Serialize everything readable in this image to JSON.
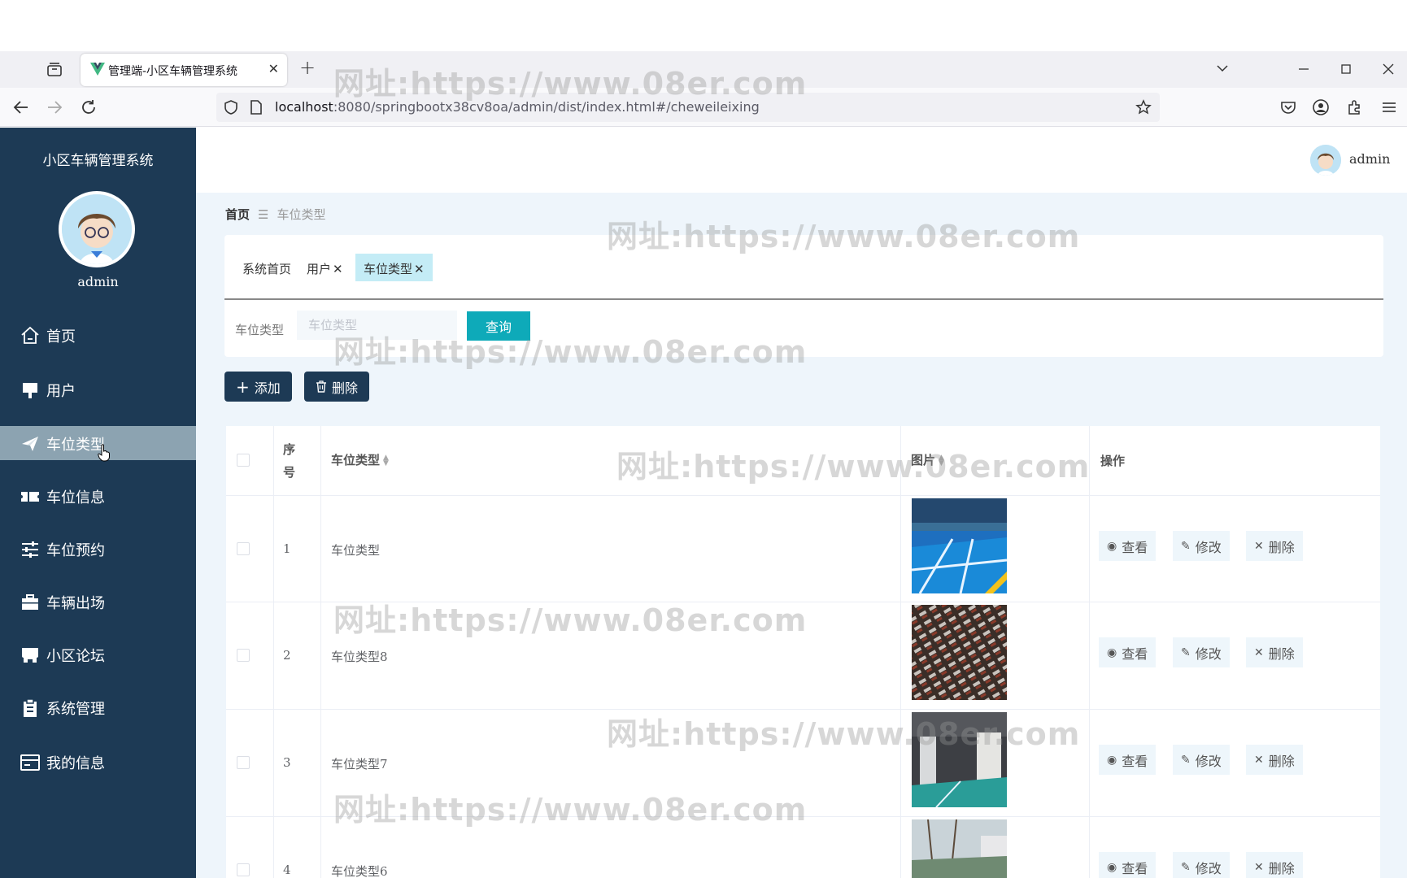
{
  "browser": {
    "tab_title": "管理端-小区车辆管理系统",
    "tab_close": "✕",
    "new_tab": "+",
    "url_host": "localhost",
    "url_rest": ":8080/springbootx38cv8oa/admin/dist/index.html#/cheweileixing"
  },
  "sidebar": {
    "title": "小区车辆管理系统",
    "username": "admin",
    "items": [
      {
        "label": "首页",
        "icon": "home-icon"
      },
      {
        "label": "用户",
        "icon": "user-icon"
      },
      {
        "label": "车位类型",
        "icon": "send-icon"
      },
      {
        "label": "车位信息",
        "icon": "ticket-icon"
      },
      {
        "label": "车位预约",
        "icon": "sliders-icon"
      },
      {
        "label": "车辆出场",
        "icon": "briefcase-icon"
      },
      {
        "label": "小区论坛",
        "icon": "store-icon"
      },
      {
        "label": "系统管理",
        "icon": "clipboard-icon"
      },
      {
        "label": "我的信息",
        "icon": "card-icon"
      }
    ]
  },
  "header": {
    "username": "admin"
  },
  "breadcrumb": {
    "home": "首页",
    "separator": "☰",
    "current": "车位类型"
  },
  "tags": [
    {
      "label": "系统首页",
      "closable": false
    },
    {
      "label": "用户",
      "closable": true
    },
    {
      "label": "车位类型",
      "closable": true
    }
  ],
  "tag_close": "✕",
  "search": {
    "label": "车位类型",
    "placeholder": "车位类型",
    "button": "查询"
  },
  "actions": {
    "add": "添加",
    "add_icon": "+",
    "delete": "删除"
  },
  "table": {
    "columns": {
      "index": "序号",
      "type": "车位类型",
      "image": "图片",
      "ops": "操作"
    },
    "rows": [
      {
        "index": "1",
        "type": "车位类型"
      },
      {
        "index": "2",
        "type": "车位类型8"
      },
      {
        "index": "3",
        "type": "车位类型7"
      },
      {
        "index": "4",
        "type": "车位类型6"
      }
    ],
    "ops": {
      "view": "查看",
      "edit": "修改",
      "delete": "删除"
    }
  },
  "watermark": "网址:https://www.08er.com",
  "colors": {
    "sidebar": "#1d3a55",
    "accent": "#0eaab9",
    "active_menu": "#8ca3b1"
  }
}
